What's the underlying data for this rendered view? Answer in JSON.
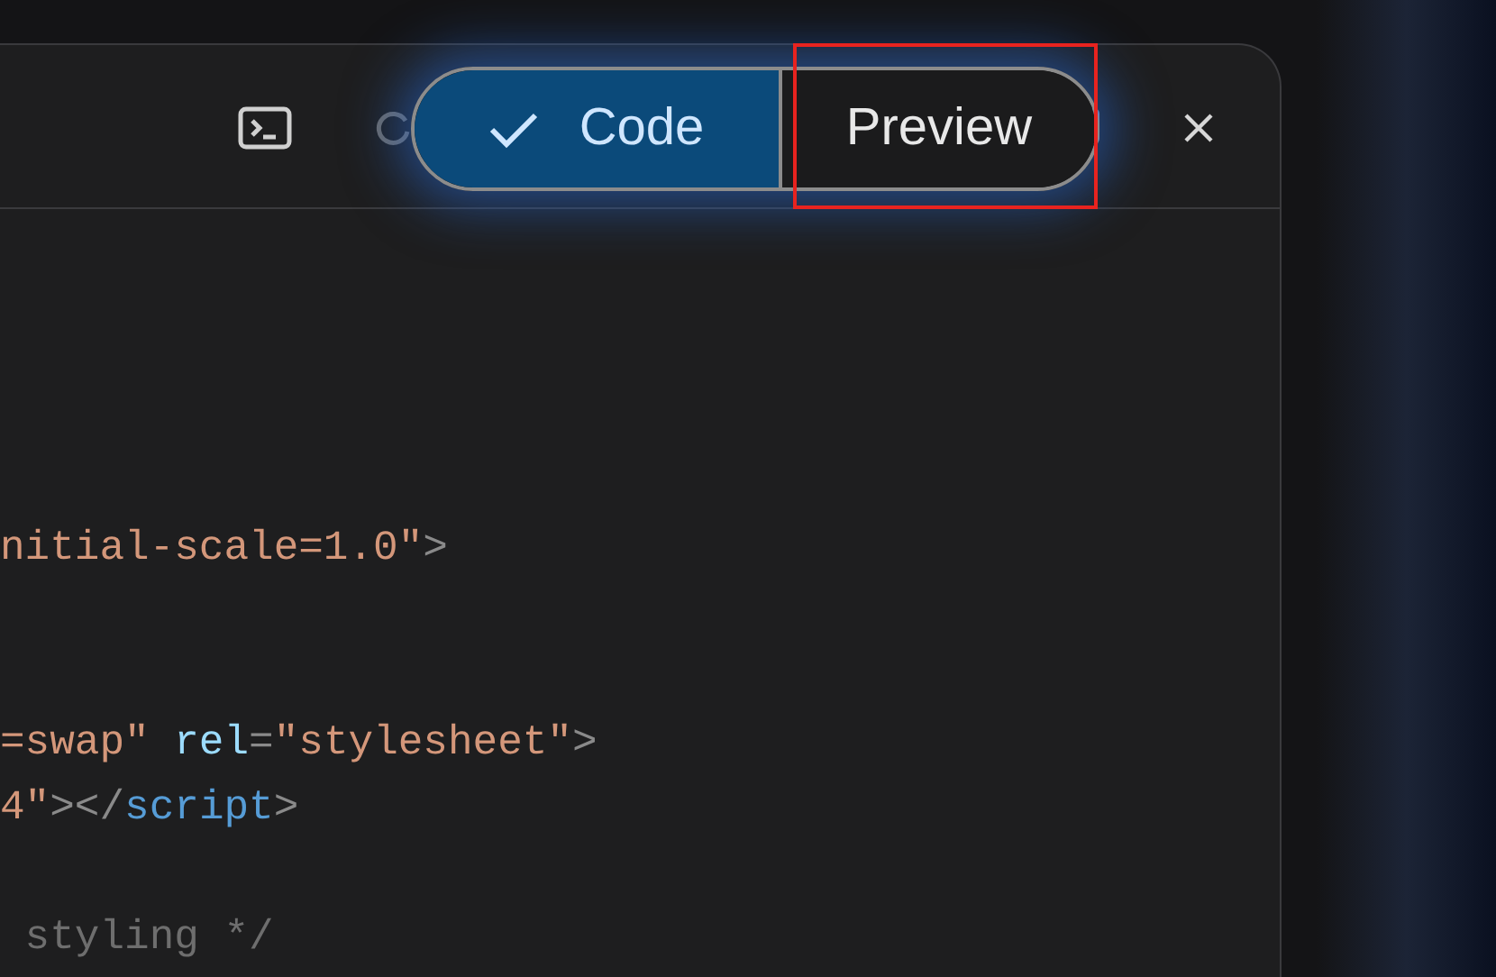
{
  "toolbar": {
    "toggle": [
      {
        "label": "Code",
        "selected": true
      },
      {
        "label": "Preview",
        "selected": false
      }
    ]
  },
  "annotation": {
    "kind": "highlight"
  },
  "code_lines": [
    {
      "kind": "blank"
    },
    {
      "kind": "blank"
    },
    {
      "kind": "blank"
    },
    {
      "kind": "blank"
    },
    {
      "kind": "code",
      "tokens": [
        {
          "text": "nitial-scale=1.0\"",
          "kind": "string"
        },
        {
          "text": ">",
          "kind": "punct"
        }
      ]
    },
    {
      "kind": "blank"
    },
    {
      "kind": "blank"
    },
    {
      "kind": "code",
      "tokens": [
        {
          "text": "=swap\" ",
          "kind": "string"
        },
        {
          "text": "rel",
          "kind": "attr"
        },
        {
          "text": "=",
          "kind": "punct"
        },
        {
          "text": "\"stylesheet\"",
          "kind": "string"
        },
        {
          "text": ">",
          "kind": "punct"
        }
      ]
    },
    {
      "kind": "code",
      "tokens": [
        {
          "text": "4\"",
          "kind": "string"
        },
        {
          "text": "></",
          "kind": "punct"
        },
        {
          "text": "script",
          "kind": "tag"
        },
        {
          "text": ">",
          "kind": "punct"
        }
      ]
    },
    {
      "kind": "blank"
    },
    {
      "kind": "code",
      "tokens": [
        {
          "text": " styling */",
          "kind": "comment"
        }
      ]
    }
  ]
}
